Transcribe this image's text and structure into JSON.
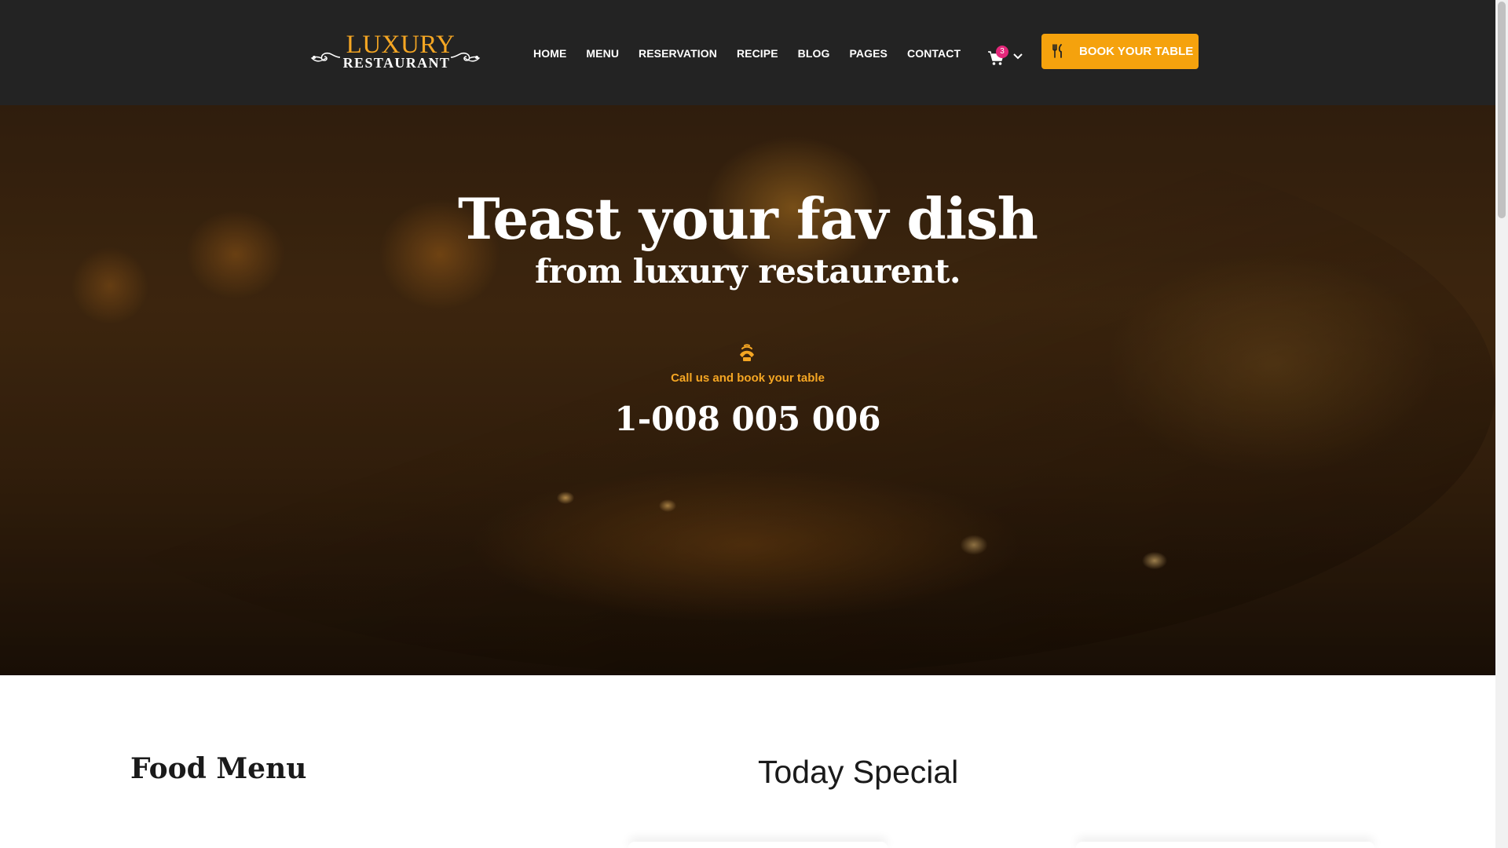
{
  "header": {
    "logo_top": "LUXURY",
    "logo_bottom": "RESTAURANT",
    "nav": [
      {
        "label": "HOME"
      },
      {
        "label": "MENU"
      },
      {
        "label": "RESERVATION"
      },
      {
        "label": "RECIPE"
      },
      {
        "label": "BLOG"
      },
      {
        "label": "PAGES"
      },
      {
        "label": "CONTACT"
      }
    ],
    "cart_count": "3",
    "cart_icon": "shopping-cart-icon",
    "book_button": "BOOK YOUR TABLE",
    "book_icon": "fork-knife-icon"
  },
  "hero": {
    "title": "Teast your fav dish",
    "subtitle": "from luxury restaurent.",
    "phone_icon": "phone-ringing-icon",
    "call_text": "Call us and book your table",
    "phone_number": "1-008 005 006"
  },
  "sections": {
    "food_menu_title": "Food Menu",
    "today_special_title": "Today Special"
  },
  "colors": {
    "header_bg": "#232323",
    "accent": "#f5a20d",
    "badge": "#e4277a"
  }
}
